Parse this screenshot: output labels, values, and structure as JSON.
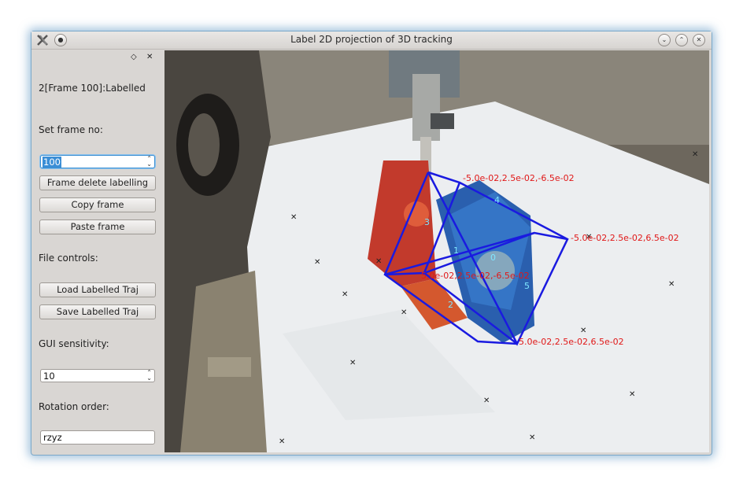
{
  "window": {
    "title": "Label 2D projection of 3D tracking"
  },
  "panel": {
    "status_text": "2[Frame 100]:Labelled",
    "set_frame_label": "Set frame no:",
    "frame_value": "100",
    "delete_button": "Frame delete labelling",
    "copy_button": "Copy frame",
    "paste_button": "Paste frame",
    "file_controls_label": "File controls:",
    "load_button": "Load Labelled Traj",
    "save_button": "Save Labelled Traj",
    "sensitivity_label": "GUI sensitivity:",
    "sensitivity_value": "10",
    "rotation_label": "Rotation order:",
    "rotation_value": "rzyz"
  },
  "overlay": {
    "vertex_labels": [
      "0",
      "1",
      "2",
      "3",
      "4",
      "5"
    ],
    "corner_coords": [
      "-5.0e-02,2.5e-02,-6.5e-02",
      "-5.0e-02,2.5e-02,6.5e-02",
      "5.0e-02,2.5e-02,-6.5e-02",
      "5.0e-02,2.5e-02,6.5e-02"
    ],
    "box_color": "#1a1ae0",
    "coord_color": "#e01818",
    "vertex_label_color": "#7fe6ff"
  }
}
